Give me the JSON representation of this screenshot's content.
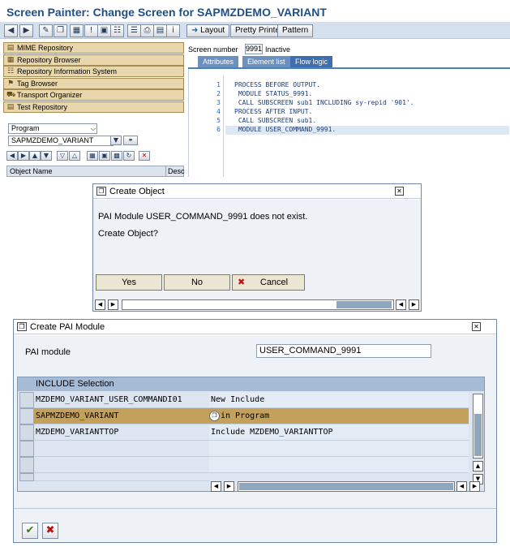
{
  "window": {
    "title": "Screen Painter: Change Screen for SAPMZDEMO_VARIANT"
  },
  "toolbar": {
    "icons": [
      "arrow-left-icon",
      "arrow-right-icon",
      "pencil-icon",
      "copy-icon",
      "hierarchy-icon",
      "info-icon",
      "layout-box-icon",
      "structure-icon",
      "tree-icon",
      "print-icon",
      "object-list-icon",
      "info-box-icon",
      "arrow-right-icon"
    ],
    "layout_label": "Layout",
    "pretty_printer_label": "Pretty Printer",
    "pattern_label": "Pattern"
  },
  "navigator": {
    "items": [
      {
        "label": "MIME Repository",
        "icon": "mime-icon"
      },
      {
        "label": "Repository Browser",
        "icon": "repository-icon"
      },
      {
        "label": "Repository Information System",
        "icon": "info-system-icon"
      },
      {
        "label": "Tag Browser",
        "icon": "tag-icon"
      },
      {
        "label": "Transport Organizer",
        "icon": "transport-icon"
      },
      {
        "label": "Test Repository",
        "icon": "test-icon"
      }
    ],
    "object_type": "Program",
    "object_name": "SAPMZDEMO_VARIANT",
    "tree_headers": {
      "name": "Object Name",
      "desc": "Desc"
    }
  },
  "screen": {
    "number_label": "Screen number",
    "number_value": "9991",
    "status": "Inactive",
    "tabs": [
      "Attributes",
      "Element list",
      "Flow logic"
    ],
    "active_tab": "Flow logic"
  },
  "flow_logic": {
    "lines": [
      {
        "n": "1",
        "text": "PROCESS BEFORE OUTPUT."
      },
      {
        "n": "2",
        "text": " MODULE STATUS_9991."
      },
      {
        "n": "3",
        "text": " CALL SUBSCREEN sub1 INCLUDING sy-repid '901'."
      },
      {
        "n": "4",
        "text": "PROCESS AFTER INPUT."
      },
      {
        "n": "5",
        "text": " CALL SUBSCREEN sub1."
      },
      {
        "n": "6",
        "text": " MODULE USER_COMMAND_9991."
      }
    ]
  },
  "create_object_dialog": {
    "title": "Create Object",
    "message1": "PAI Module USER_COMMAND_9991 does not exist.",
    "message2": "Create Object?",
    "yes_label": "Yes",
    "no_label": "No",
    "cancel_label": "Cancel"
  },
  "pai_dialog": {
    "title": "Create PAI Module",
    "field_label": "PAI module",
    "field_value": "USER_COMMAND_9991",
    "section_title": "INCLUDE Selection",
    "rows": [
      {
        "include": "MZDEMO_VARIANT_USER_COMMANDI01",
        "desc": "New Include",
        "selected": false
      },
      {
        "include": "SAPMZDEMO_VARIANT",
        "desc": "in Program",
        "selected": true
      },
      {
        "include": "MZDEMO_VARIANTTOP",
        "desc": "Include MZDEMO_VARIANTTOP",
        "selected": false
      },
      {
        "include": "",
        "desc": "",
        "selected": false
      },
      {
        "include": "",
        "desc": "",
        "selected": false
      },
      {
        "include": "",
        "desc": "",
        "selected": false
      }
    ]
  },
  "colors": {
    "title": "#1f4f8a",
    "nav_item": "#e8d7ad",
    "selected_row": "#c4a15a",
    "tab_active": "#3d6fb0"
  }
}
